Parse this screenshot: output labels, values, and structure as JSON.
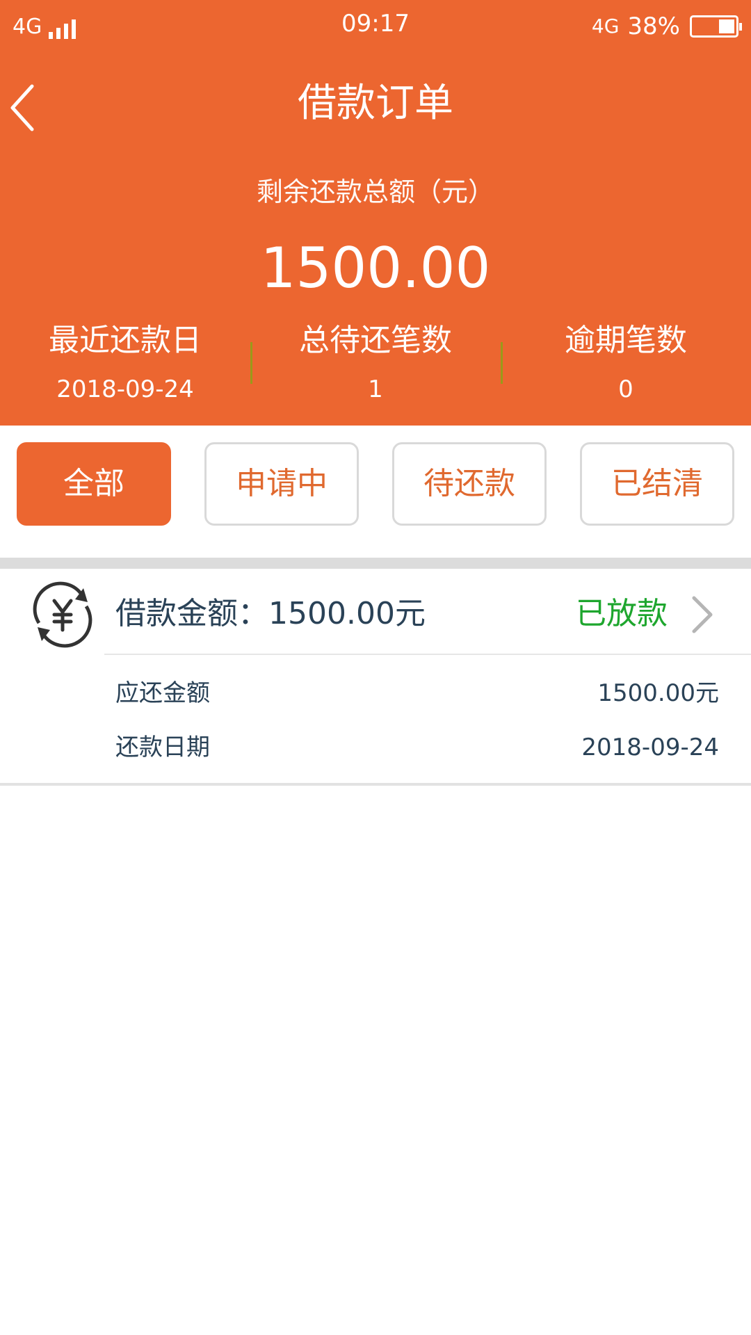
{
  "status_bar": {
    "network_left": "4G",
    "time": "09:17",
    "network_right": "4G",
    "battery_percent": "38%",
    "battery_level": 0.38
  },
  "nav": {
    "title": "借款订单",
    "back_icon": "chevron-left-icon"
  },
  "summary": {
    "total_label": "剩余还款总额（元）",
    "total_amount": "1500.00",
    "stats": [
      {
        "label": "最近还款日",
        "value": "2018-09-24"
      },
      {
        "label": "总待还笔数",
        "value": "1"
      },
      {
        "label": "逾期笔数",
        "value": "0"
      }
    ]
  },
  "tabs": [
    {
      "label": "全部",
      "active": true
    },
    {
      "label": "申请中",
      "active": false
    },
    {
      "label": "待还款",
      "active": false
    },
    {
      "label": "已结清",
      "active": false
    }
  ],
  "order": {
    "icon": "yuan-refresh-icon",
    "loan_amount_label": "借款金额：1500.00元",
    "status": "已放款",
    "rows": [
      {
        "label": "应还金额",
        "value": "1500.00元"
      },
      {
        "label": "还款日期",
        "value": "2018-09-24"
      }
    ]
  },
  "colors": {
    "brand": "#EC6630",
    "status_green": "#1EA62E",
    "text_dark": "#2A4257"
  }
}
